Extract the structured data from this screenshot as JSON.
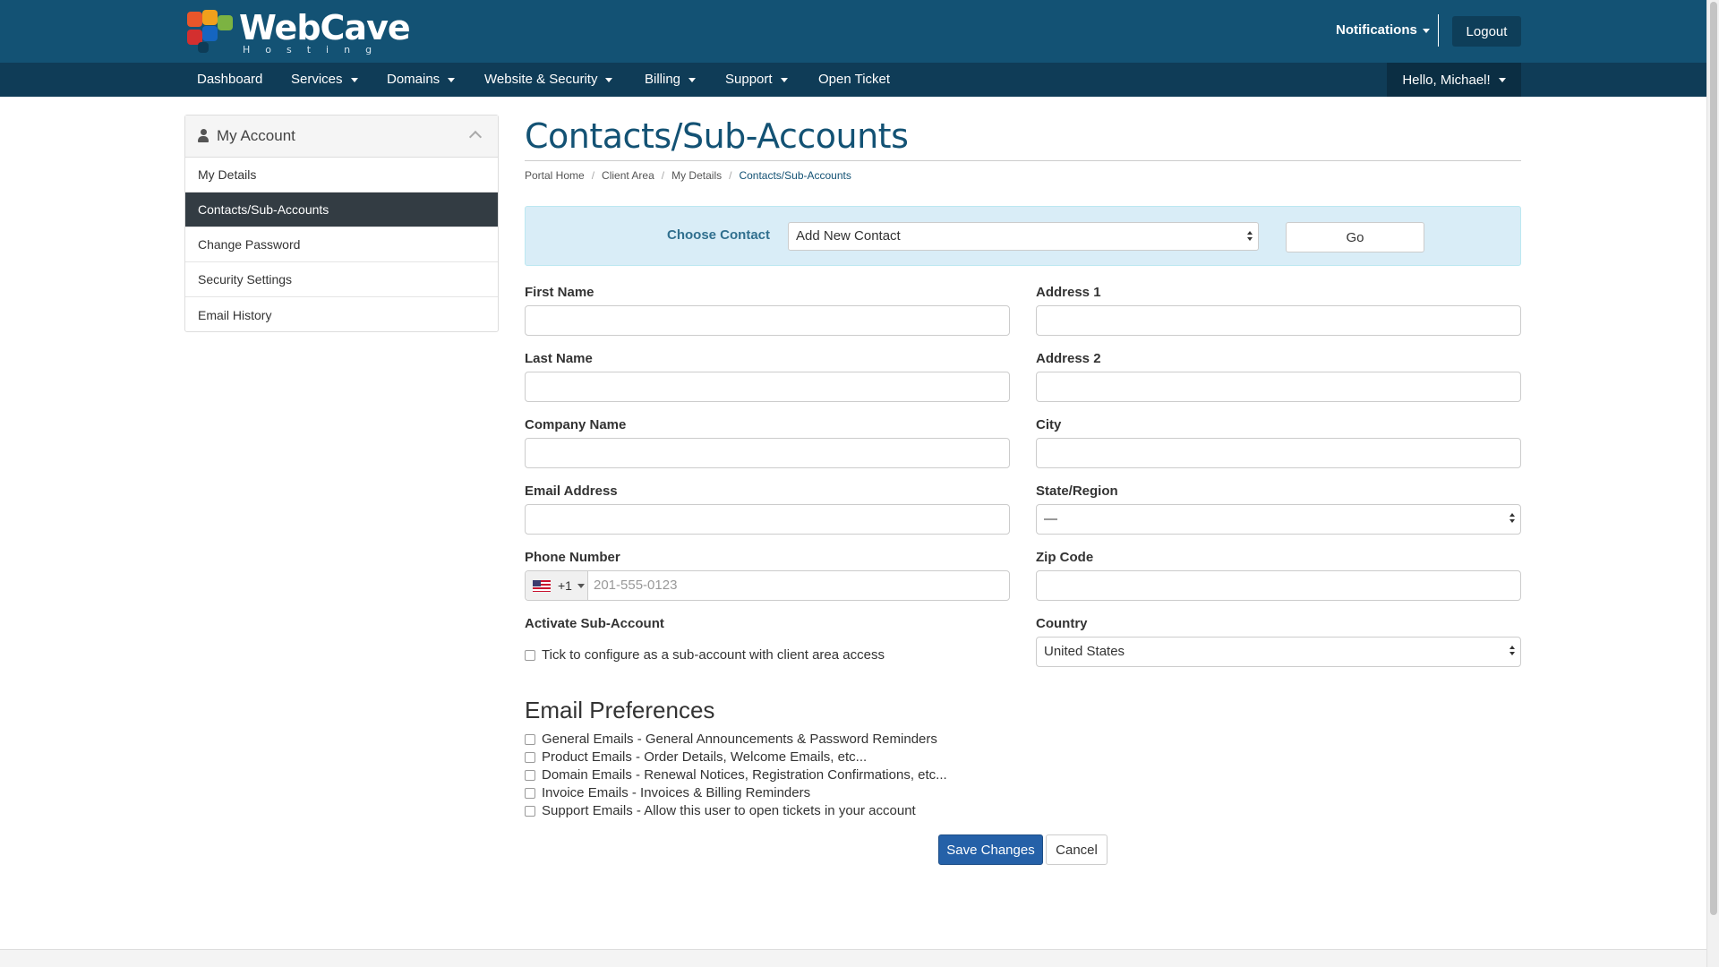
{
  "brand": {
    "name": "WebCave",
    "tagline": "Hosting",
    "hex_colors": [
      "#e8562a",
      "#f0a01c",
      "#7cb342",
      "#d32f2f",
      "#1565c0",
      "#0d3c57"
    ]
  },
  "header": {
    "notifications": "Notifications",
    "logout": "Logout"
  },
  "nav": {
    "items": [
      {
        "label": "Dashboard",
        "dropdown": false
      },
      {
        "label": "Services",
        "dropdown": true
      },
      {
        "label": "Domains",
        "dropdown": true
      },
      {
        "label": "Website & Security",
        "dropdown": true
      },
      {
        "label": "Billing",
        "dropdown": true
      },
      {
        "label": "Support",
        "dropdown": true
      },
      {
        "label": "Open Ticket",
        "dropdown": false
      }
    ],
    "greeting": "Hello, Michael!"
  },
  "sidebar": {
    "title": "My Account",
    "items": [
      {
        "label": "My Details",
        "active": false
      },
      {
        "label": "Contacts/Sub-Accounts",
        "active": true
      },
      {
        "label": "Change Password",
        "active": false
      },
      {
        "label": "Security Settings",
        "active": false
      },
      {
        "label": "Email History",
        "active": false
      }
    ]
  },
  "page": {
    "title": "Contacts/Sub-Accounts",
    "breadcrumb": [
      "Portal Home",
      "Client Area",
      "My Details",
      "Contacts/Sub-Accounts"
    ]
  },
  "choose_contact": {
    "label": "Choose Contact",
    "selected": "Add New Contact",
    "go": "Go"
  },
  "form": {
    "first_name": {
      "label": "First Name",
      "value": ""
    },
    "last_name": {
      "label": "Last Name",
      "value": ""
    },
    "company_name": {
      "label": "Company Name",
      "value": ""
    },
    "email": {
      "label": "Email Address",
      "value": ""
    },
    "phone": {
      "label": "Phone Number",
      "country_code": "+1",
      "placeholder": "201-555-0123"
    },
    "activate": {
      "label": "Activate Sub-Account",
      "checkbox_text": "Tick to configure as a sub-account with client area access"
    },
    "address1": {
      "label": "Address 1",
      "value": ""
    },
    "address2": {
      "label": "Address 2",
      "value": ""
    },
    "city": {
      "label": "City",
      "value": ""
    },
    "state": {
      "label": "State/Region",
      "value": "—"
    },
    "zip": {
      "label": "Zip Code",
      "value": ""
    },
    "country": {
      "label": "Country",
      "value": "United States"
    }
  },
  "email_prefs": {
    "title": "Email Preferences",
    "items": [
      "General Emails - General Announcements & Password Reminders",
      "Product Emails - Order Details, Welcome Emails, etc...",
      "Domain Emails - Renewal Notices, Registration Confirmations, etc...",
      "Invoice Emails - Invoices & Billing Reminders",
      "Support Emails - Allow this user to open tickets in your account"
    ]
  },
  "actions": {
    "save": "Save Changes",
    "cancel": "Cancel"
  }
}
